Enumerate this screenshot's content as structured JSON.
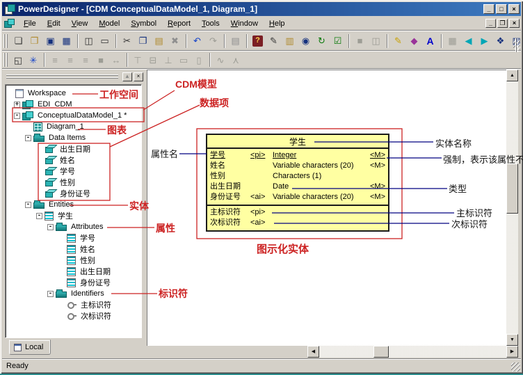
{
  "theme": {
    "titlebar_start": "#0a246a",
    "titlebar_end": "#3d7ac0",
    "entity_fill": "#ffffa2",
    "annotation_red": "#cc2222",
    "callout_navy": "#000080"
  },
  "window": {
    "title": "PowerDesigner - [CDM ConceptualDataModel_1, Diagram_1]",
    "status": "Ready",
    "controls": {
      "minimize": "_",
      "maximize": "□",
      "close": "×"
    },
    "mdi_controls": {
      "minimize": "_",
      "restore": "❐",
      "close": "×"
    }
  },
  "menu": {
    "items": [
      {
        "name": "menu-file",
        "label": "File"
      },
      {
        "name": "menu-edit",
        "label": "Edit"
      },
      {
        "name": "menu-view",
        "label": "View"
      },
      {
        "name": "menu-model",
        "label": "Model"
      },
      {
        "name": "menu-symbol",
        "label": "Symbol"
      },
      {
        "name": "menu-report",
        "label": "Report"
      },
      {
        "name": "menu-tools",
        "label": "Tools"
      },
      {
        "name": "menu-window",
        "label": "Window"
      },
      {
        "name": "menu-help",
        "label": "Help"
      }
    ]
  },
  "toolbar_main": {
    "buttons": [
      {
        "name": "new-button",
        "glyph": "❏",
        "cls": "c-ink",
        "inter": "true"
      },
      {
        "name": "open-button",
        "glyph": "❒",
        "cls": "c-tan",
        "inter": "true"
      },
      {
        "name": "save-button",
        "glyph": "▣",
        "cls": "c-nav",
        "inter": "true"
      },
      {
        "name": "save-all-button",
        "glyph": "▦",
        "cls": "c-nav",
        "inter": "true"
      },
      {
        "name": "toolbar-separator",
        "glyph": "",
        "cls": "sep",
        "inter": "false"
      },
      {
        "name": "print-preview-button",
        "glyph": "◫",
        "cls": "c-ink",
        "inter": "true"
      },
      {
        "name": "print-button",
        "glyph": "▭",
        "cls": "c-ink",
        "inter": "true"
      },
      {
        "name": "toolbar-separator",
        "glyph": "",
        "cls": "sep",
        "inter": "false"
      },
      {
        "name": "cut-button",
        "glyph": "✂",
        "cls": "c-ink",
        "inter": "true"
      },
      {
        "name": "copy-button",
        "glyph": "❐",
        "cls": "c-nav",
        "inter": "true"
      },
      {
        "name": "paste-button",
        "glyph": "▤",
        "cls": "c-tan",
        "inter": "true"
      },
      {
        "name": "delete-button",
        "glyph": "✖",
        "cls": "c-gray",
        "inter": "true"
      },
      {
        "name": "toolbar-separator",
        "glyph": "",
        "cls": "sep",
        "inter": "false"
      },
      {
        "name": "undo-button",
        "glyph": "↶",
        "cls": "c-blue",
        "inter": "true"
      },
      {
        "name": "redo-button",
        "glyph": "↷",
        "cls": "dis",
        "inter": "true"
      },
      {
        "name": "toolbar-separator",
        "glyph": "",
        "cls": "sep",
        "inter": "false"
      },
      {
        "name": "properties-button",
        "glyph": "▤",
        "cls": "c-gray",
        "inter": "true"
      },
      {
        "name": "toolbar-separator",
        "glyph": "",
        "cls": "sep",
        "inter": "false"
      },
      {
        "name": "help-button",
        "glyph": "?",
        "cls": "bk",
        "inter": "true"
      },
      {
        "name": "toolbar-gripper",
        "glyph": "",
        "cls": "grip",
        "inter": "false"
      },
      {
        "name": "check-model-button",
        "glyph": "✎",
        "cls": "c-ink",
        "inter": "true"
      },
      {
        "name": "merge-model-button",
        "glyph": "▥",
        "cls": "c-tan",
        "inter": "true"
      },
      {
        "name": "find-button",
        "glyph": "◉",
        "cls": "c-nav",
        "inter": "true"
      },
      {
        "name": "refresh-button",
        "glyph": "↻",
        "cls": "c-green",
        "inter": "true"
      },
      {
        "name": "check-button",
        "glyph": "☑",
        "cls": "c-green",
        "inter": "true"
      },
      {
        "name": "toolbar-separator",
        "glyph": "",
        "cls": "sep",
        "inter": "false"
      },
      {
        "name": "ole-object-button",
        "glyph": "■",
        "cls": "dis",
        "inter": "true"
      },
      {
        "name": "title-frame-button",
        "glyph": "◫",
        "cls": "dis",
        "inter": "true"
      },
      {
        "name": "toolbar-separator",
        "glyph": "",
        "cls": "sep",
        "inter": "false"
      },
      {
        "name": "pen-style-button",
        "glyph": "✎",
        "cls": "c-yel",
        "inter": "true"
      },
      {
        "name": "fill-style-button",
        "glyph": "◆",
        "cls": "c-mag",
        "inter": "true"
      },
      {
        "name": "font-button",
        "glyph": "A",
        "cls": "c-font",
        "inter": "true"
      },
      {
        "name": "toolbar-separator",
        "glyph": "",
        "cls": "sep",
        "inter": "false"
      },
      {
        "name": "grid-button",
        "glyph": "▦",
        "cls": "dis",
        "inter": "true"
      },
      {
        "name": "previous-diagram-button",
        "glyph": "◀",
        "cls": "c-cyan",
        "inter": "true"
      },
      {
        "name": "next-diagram-button",
        "glyph": "▶",
        "cls": "c-cyan",
        "inter": "true"
      },
      {
        "name": "toolbar-gripper",
        "glyph": "",
        "cls": "grip",
        "inter": "false"
      },
      {
        "name": "browser-window-button",
        "glyph": "❖",
        "cls": "c-nav",
        "inter": "true"
      },
      {
        "name": "output-window-button",
        "glyph": "▥",
        "cls": "c-nav",
        "inter": "true"
      }
    ]
  },
  "toolbar_symbol": {
    "buttons": [
      {
        "name": "fit-page-button",
        "glyph": "◱",
        "cls": "c-ink",
        "inter": "true"
      },
      {
        "name": "display-preferences-button",
        "glyph": "✳",
        "cls": "c-blue",
        "inter": "true"
      },
      {
        "name": "toolbar-separator",
        "glyph": "",
        "cls": "sep",
        "inter": "false"
      },
      {
        "name": "align-left-button",
        "glyph": "≡",
        "cls": "dis",
        "inter": "true"
      },
      {
        "name": "align-center-button",
        "glyph": "≡",
        "cls": "dis",
        "inter": "true"
      },
      {
        "name": "align-right-button",
        "glyph": "≡",
        "cls": "dis",
        "inter": "true"
      },
      {
        "name": "same-size-button",
        "glyph": "■",
        "cls": "dis",
        "inter": "true"
      },
      {
        "name": "space-horizontally-button",
        "glyph": "↔",
        "cls": "dis",
        "inter": "true"
      },
      {
        "name": "toolbar-separator",
        "glyph": "",
        "cls": "sep",
        "inter": "false"
      },
      {
        "name": "align-top-button",
        "glyph": "⊤",
        "cls": "dis",
        "inter": "true"
      },
      {
        "name": "align-middle-button",
        "glyph": "⊟",
        "cls": "dis",
        "inter": "true"
      },
      {
        "name": "align-bottom-button",
        "glyph": "⊥",
        "cls": "dis",
        "inter": "true"
      },
      {
        "name": "same-width-button",
        "glyph": "▭",
        "cls": "dis",
        "inter": "true"
      },
      {
        "name": "same-height-button",
        "glyph": "▯",
        "cls": "dis",
        "inter": "true"
      },
      {
        "name": "toolbar-separator",
        "glyph": "",
        "cls": "sep",
        "inter": "false"
      },
      {
        "name": "link-style-button",
        "glyph": "∿",
        "cls": "dis",
        "inter": "true"
      },
      {
        "name": "auto-layout-button",
        "glyph": "⋏",
        "cls": "dis",
        "inter": "true"
      }
    ]
  },
  "browser": {
    "collapse_glyph": "▲",
    "close_glyph": "×",
    "tab_label": "Local",
    "tree": [
      {
        "name": "tree-item-workspace",
        "label": "Workspace",
        "cls": "lvl0 icn-workspace",
        "exp": ""
      },
      {
        "name": "tree-item-edi-cdm",
        "label": "EDI_CDM",
        "cls": "lvl1 icn-model",
        "exp": "+"
      },
      {
        "name": "tree-item-conceptual-data-model-1",
        "label": "ConceptualDataModel_1 *",
        "cls": "lvl1 icn-model",
        "exp": "-"
      },
      {
        "name": "tree-item-diagram-1",
        "label": "Diagram_1",
        "cls": "lvl2 icn-diagram",
        "exp": ""
      },
      {
        "name": "tree-item-data-items",
        "label": "Data Items",
        "cls": "lvl2 icn-folder",
        "exp": "-"
      },
      {
        "name": "tree-item-dataitem-birthdate",
        "label": "出生日期",
        "cls": "lvl3 icn-cube",
        "exp": ""
      },
      {
        "name": "tree-item-dataitem-name",
        "label": "姓名",
        "cls": "lvl3 icn-cube",
        "exp": ""
      },
      {
        "name": "tree-item-dataitem-studentno",
        "label": "学号",
        "cls": "lvl3 icn-cube",
        "exp": ""
      },
      {
        "name": "tree-item-dataitem-gender",
        "label": "性别",
        "cls": "lvl3 icn-cube",
        "exp": ""
      },
      {
        "name": "tree-item-dataitem-idnumber",
        "label": "身份证号",
        "cls": "lvl3 icn-cube",
        "exp": ""
      },
      {
        "name": "tree-item-entities",
        "label": "Entities",
        "cls": "lvl2 icn-folder",
        "exp": "-"
      },
      {
        "name": "tree-item-entity-student",
        "label": "学生",
        "cls": "lvl3 icn-table",
        "exp": "-"
      },
      {
        "name": "tree-item-attributes",
        "label": "Attributes",
        "cls": "lvl4 icn-folder",
        "exp": "-"
      },
      {
        "name": "tree-item-attribute-studentno",
        "label": "学号",
        "cls": "lvl5 icn-table",
        "exp": ""
      },
      {
        "name": "tree-item-attribute-name",
        "label": "姓名",
        "cls": "lvl5 icn-table",
        "exp": ""
      },
      {
        "name": "tree-item-attribute-gender",
        "label": "性别",
        "cls": "lvl5 icn-table",
        "exp": ""
      },
      {
        "name": "tree-item-attribute-birthdate",
        "label": "出生日期",
        "cls": "lvl5 icn-table",
        "exp": ""
      },
      {
        "name": "tree-item-attribute-idnumber",
        "label": "身份证号",
        "cls": "lvl5 icn-table",
        "exp": ""
      },
      {
        "name": "tree-item-identifiers",
        "label": "Identifiers",
        "cls": "lvl4 icn-folder",
        "exp": "-"
      },
      {
        "name": "tree-item-identifier-primary",
        "label": "主标识符",
        "cls": "lvl5 icn-key",
        "exp": ""
      },
      {
        "name": "tree-item-identifier-secondary",
        "label": "次标识符",
        "cls": "lvl5 icn-key",
        "exp": ""
      }
    ]
  },
  "canvas": {
    "entity": {
      "title": "学生",
      "attributes": [
        {
          "name": "学号",
          "key": "<pi>",
          "type": "Integer",
          "mand": "<M>",
          "cls": "u"
        },
        {
          "name": "姓名",
          "key": "",
          "type": "Variable characters (20)",
          "mand": "<M>",
          "cls": ""
        },
        {
          "name": "性别",
          "key": "",
          "type": "Characters (1)",
          "mand": "",
          "cls": ""
        },
        {
          "name": "出生日期",
          "key": "",
          "type": "Date",
          "mand": "<M>",
          "cls": ""
        },
        {
          "name": "身份证号",
          "key": "<ai>",
          "type": "Variable characters (20)",
          "mand": "<M>",
          "cls": ""
        }
      ],
      "identifiers": [
        {
          "name": "主标识符",
          "key": "<pi>"
        },
        {
          "name": "次标识符",
          "key": "<ai>"
        }
      ]
    }
  },
  "scrollbars": {
    "up": "▲",
    "down": "▼",
    "left": "◀",
    "right": "▶"
  },
  "annotations": {
    "workspace": "工作空间",
    "cdm_model": "CDM模型",
    "data_items": "数据项",
    "diagram": "图表",
    "entities": "实体",
    "attributes": "属性",
    "identifiers": "标识符",
    "graphical_entity": "图示化实体",
    "attribute_name": "属性名",
    "entity_name": "实体名称",
    "mandatory": "强制，表示该属性不能",
    "type_label": "类型",
    "primary_identifier": "主标识符",
    "secondary_identifier": "次标识符"
  }
}
